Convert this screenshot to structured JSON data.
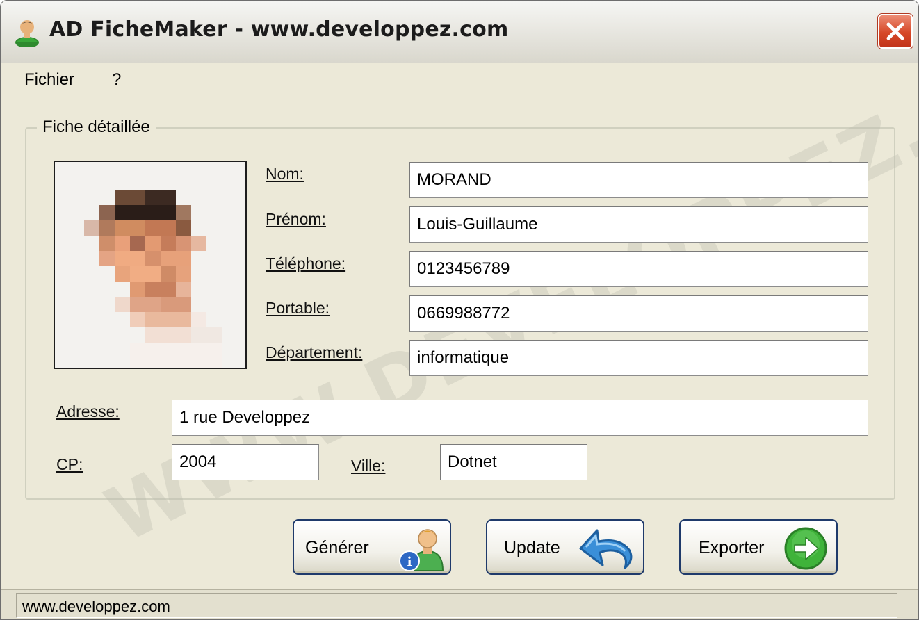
{
  "window": {
    "title": "AD FicheMaker - www.developpez.com"
  },
  "menu": {
    "items": [
      {
        "label": "Fichier"
      },
      {
        "label": "?"
      }
    ]
  },
  "group": {
    "title": "Fiche détaillée",
    "watermark": "WWW.DEVELOPPEZ.COM"
  },
  "fields": {
    "nom": {
      "label": "Nom:",
      "value": "MORAND"
    },
    "prenom": {
      "label": "Prénom:",
      "value": "Louis-Guillaume"
    },
    "telephone": {
      "label": "Téléphone:",
      "value": "0123456789"
    },
    "portable": {
      "label": "Portable:",
      "value": "0669988772"
    },
    "departement": {
      "label": "Département:",
      "value": "informatique"
    },
    "adresse": {
      "label": "Adresse:",
      "value": "1 rue Developpez"
    },
    "cp": {
      "label": "CP:",
      "value": "2004"
    },
    "ville": {
      "label": "Ville:",
      "value": "Dotnet"
    }
  },
  "buttons": {
    "generer": {
      "label": "Générer",
      "icon": "user-info-icon"
    },
    "update": {
      "label": "Update",
      "icon": "undo-arrow-icon"
    },
    "exporter": {
      "label": "Exporter",
      "icon": "green-arrow-right-icon"
    }
  },
  "statusbar": {
    "text": "www.developpez.com"
  },
  "colors": {
    "window_bg": "#ece9d8",
    "close_button": "#d64828",
    "button_border": "#1f3a6b",
    "export_icon": "#3fb33a",
    "update_icon": "#3a8fd8"
  }
}
